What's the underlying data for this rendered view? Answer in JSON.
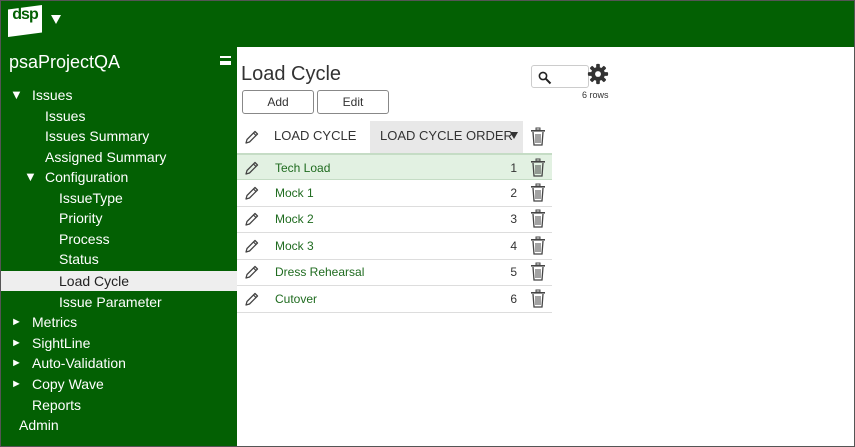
{
  "app": {
    "logo_text": "dsp"
  },
  "sidebar": {
    "project": "psaProjectQA",
    "items": [
      {
        "label": "Issues",
        "arrow": "▼"
      },
      {
        "label": "Issues"
      },
      {
        "label": "Issues Summary"
      },
      {
        "label": "Assigned Summary"
      },
      {
        "label": "Configuration",
        "arrow": "▼"
      },
      {
        "label": "IssueType"
      },
      {
        "label": "Priority"
      },
      {
        "label": "Process"
      },
      {
        "label": "Status"
      },
      {
        "label": "Load Cycle",
        "selected": true
      },
      {
        "label": "Issue Parameter"
      },
      {
        "label": "Metrics",
        "arrow": "►"
      },
      {
        "label": "SightLine",
        "arrow": "►"
      },
      {
        "label": "Auto-Validation",
        "arrow": "►"
      },
      {
        "label": "Copy Wave",
        "arrow": "►"
      },
      {
        "label": "Reports"
      },
      {
        "label": "Admin"
      }
    ]
  },
  "main": {
    "title": "Load Cycle",
    "add_label": "Add",
    "edit_label": "Edit",
    "rows_count": "6 rows",
    "columns": [
      "LOAD CYCLE",
      "LOAD CYCLE ORDER"
    ],
    "rows": [
      {
        "name": "Tech Load",
        "order": "1"
      },
      {
        "name": "Mock 1",
        "order": "2"
      },
      {
        "name": "Mock 2",
        "order": "3"
      },
      {
        "name": "Mock 3",
        "order": "4"
      },
      {
        "name": "Dress Rehearsal",
        "order": "5"
      },
      {
        "name": "Cutover",
        "order": "6"
      }
    ]
  },
  "colors": {
    "brand_green": "#036003",
    "link_green": "#1f6b1f",
    "selected_row": "#e2f1e2"
  }
}
